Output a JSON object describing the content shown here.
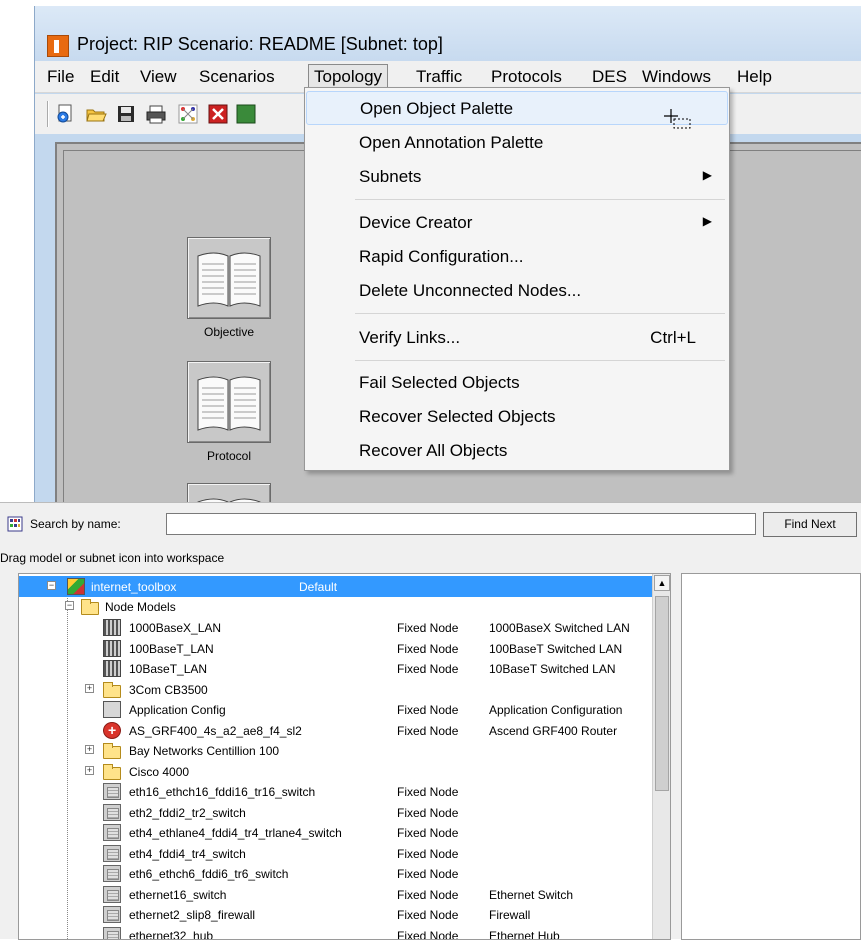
{
  "window": {
    "title": "Project: RIP Scenario: README  [Subnet: top]"
  },
  "menu_bar": {
    "items": [
      "File",
      "Edit",
      "View",
      "Scenarios",
      "Topology",
      "Traffic",
      "Protocols",
      "DES",
      "Windows",
      "Help"
    ]
  },
  "toolbar": {
    "buttons": [
      "new-icon",
      "open-icon",
      "save-icon",
      "print-icon",
      "node-palette-icon",
      "fail-icon",
      "recover-icon"
    ]
  },
  "workspace": {
    "books": [
      {
        "label": "Objective"
      },
      {
        "label": "Protocol"
      }
    ]
  },
  "topology_menu": {
    "items": [
      {
        "label": "Open Object Palette",
        "highlighted": true
      },
      {
        "label": "Open Annotation Palette"
      },
      {
        "label": "Subnets",
        "submenu": true
      },
      {
        "label": "Device Creator",
        "submenu": true
      },
      {
        "label": "Rapid Configuration..."
      },
      {
        "label": "Delete Unconnected Nodes..."
      },
      {
        "label": "Verify Links...",
        "shortcut": "Ctrl+L"
      },
      {
        "label": "Fail Selected Objects"
      },
      {
        "label": "Recover Selected Objects"
      },
      {
        "label": "Recover All Objects"
      }
    ]
  },
  "palette": {
    "search_label": "Search by name:",
    "search_value": "",
    "find_next_label": "Find Next",
    "drag_hint": "Drag model or subnet icon into workspace",
    "root": {
      "name": "internet_toolbox",
      "desc": "Default"
    },
    "group": "Node Models",
    "rows": [
      {
        "name": "1000BaseX_LAN",
        "type": "Fixed Node",
        "desc": "1000BaseX Switched LAN",
        "icon": "lan-icon"
      },
      {
        "name": "100BaseT_LAN",
        "type": "Fixed Node",
        "desc": "100BaseT Switched LAN",
        "icon": "lan-icon"
      },
      {
        "name": "10BaseT_LAN",
        "type": "Fixed Node",
        "desc": "10BaseT Switched LAN",
        "icon": "lan-icon"
      },
      {
        "name": "3Com CB3500",
        "type": "",
        "desc": "",
        "icon": "folder-icon",
        "folder": true
      },
      {
        "name": "Application Config",
        "type": "Fixed Node",
        "desc": "Application Configuration",
        "icon": "application-config-icon"
      },
      {
        "name": "AS_GRF400_4s_a2_ae8_f4_sl2",
        "type": "Fixed Node",
        "desc": "Ascend GRF400 Router",
        "icon": "router-icon"
      },
      {
        "name": "Bay Networks Centillion 100",
        "type": "",
        "desc": "",
        "icon": "folder-icon",
        "folder": true
      },
      {
        "name": "Cisco 4000",
        "type": "",
        "desc": "",
        "icon": "folder-icon",
        "folder": true
      },
      {
        "name": "eth16_ethch16_fddi16_tr16_switch",
        "type": "Fixed Node",
        "desc": "",
        "icon": "switch-icon"
      },
      {
        "name": "eth2_fddi2_tr2_switch",
        "type": "Fixed Node",
        "desc": "",
        "icon": "switch-icon"
      },
      {
        "name": "eth4_ethlane4_fddi4_tr4_trlane4_switch",
        "type": "Fixed Node",
        "desc": "",
        "icon": "switch-icon"
      },
      {
        "name": "eth4_fddi4_tr4_switch",
        "type": "Fixed Node",
        "desc": "",
        "icon": "switch-icon"
      },
      {
        "name": "eth6_ethch6_fddi6_tr6_switch",
        "type": "Fixed Node",
        "desc": "",
        "icon": "switch-icon"
      },
      {
        "name": "ethernet16_switch",
        "type": "Fixed Node",
        "desc": "Ethernet Switch",
        "icon": "switch-icon"
      },
      {
        "name": "ethernet2_slip8_firewall",
        "type": "Fixed Node",
        "desc": "Firewall",
        "icon": "switch-icon"
      },
      {
        "name": "ethernet32_hub",
        "type": "Fixed Node",
        "desc": "Ethernet Hub",
        "icon": "switch-icon"
      }
    ]
  }
}
